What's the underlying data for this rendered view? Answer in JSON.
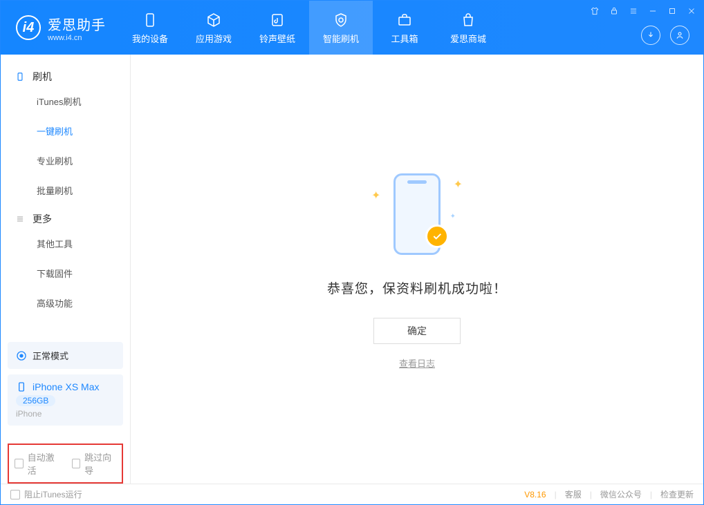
{
  "app": {
    "name_zh": "爱思助手",
    "name_en": "www.i4.cn"
  },
  "nav": {
    "my_device": "我的设备",
    "apps_games": "应用游戏",
    "ring_wall": "铃声壁纸",
    "smart_flash": "智能刷机",
    "toolbox": "工具箱",
    "store": "爱思商城"
  },
  "sidebar": {
    "section_flash": "刷机",
    "items_flash": {
      "itunes": "iTunes刷机",
      "oneclick": "一键刷机",
      "pro": "专业刷机",
      "batch": "批量刷机"
    },
    "section_more": "更多",
    "items_more": {
      "other": "其他工具",
      "firmware": "下载固件",
      "advanced": "高级功能"
    }
  },
  "device": {
    "mode": "正常模式",
    "name": "iPhone XS Max",
    "storage": "256GB",
    "type": "iPhone"
  },
  "checks": {
    "auto_activate": "自动激活",
    "skip_guide": "跳过向导"
  },
  "main": {
    "success": "恭喜您，保资料刷机成功啦！",
    "ok": "确定",
    "view_log": "查看日志"
  },
  "footer": {
    "block_itunes": "阻止iTunes运行",
    "version": "V8.16",
    "service": "客服",
    "wechat": "微信公众号",
    "update": "检查更新"
  }
}
